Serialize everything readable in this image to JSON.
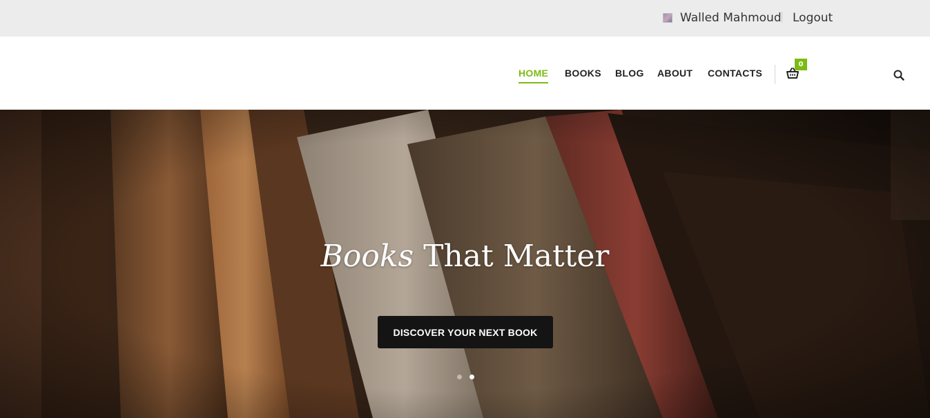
{
  "topbar": {
    "user_name": "Walled Mahmoud",
    "logout_label": "Logout"
  },
  "nav": {
    "items": [
      {
        "label": "HOME",
        "active": true
      },
      {
        "label": "BOOKS",
        "active": false
      },
      {
        "label": "BLOG",
        "active": false
      },
      {
        "label": "ABOUT",
        "active": false
      },
      {
        "label": "CONTACTS",
        "active": false
      }
    ],
    "cart_count": "0"
  },
  "hero": {
    "title_emphasis": "Books",
    "title_rest": "That Matter",
    "cta_label": "DISCOVER YOUR NEXT BOOK",
    "slides_total": 2,
    "active_slide": 2
  },
  "colors": {
    "accent": "#7cbb14",
    "topbar_bg": "#ececec",
    "cta_bg": "#141414"
  },
  "icons": {
    "avatar": "avatar-icon",
    "cart": "basket-icon",
    "search": "search-icon"
  }
}
